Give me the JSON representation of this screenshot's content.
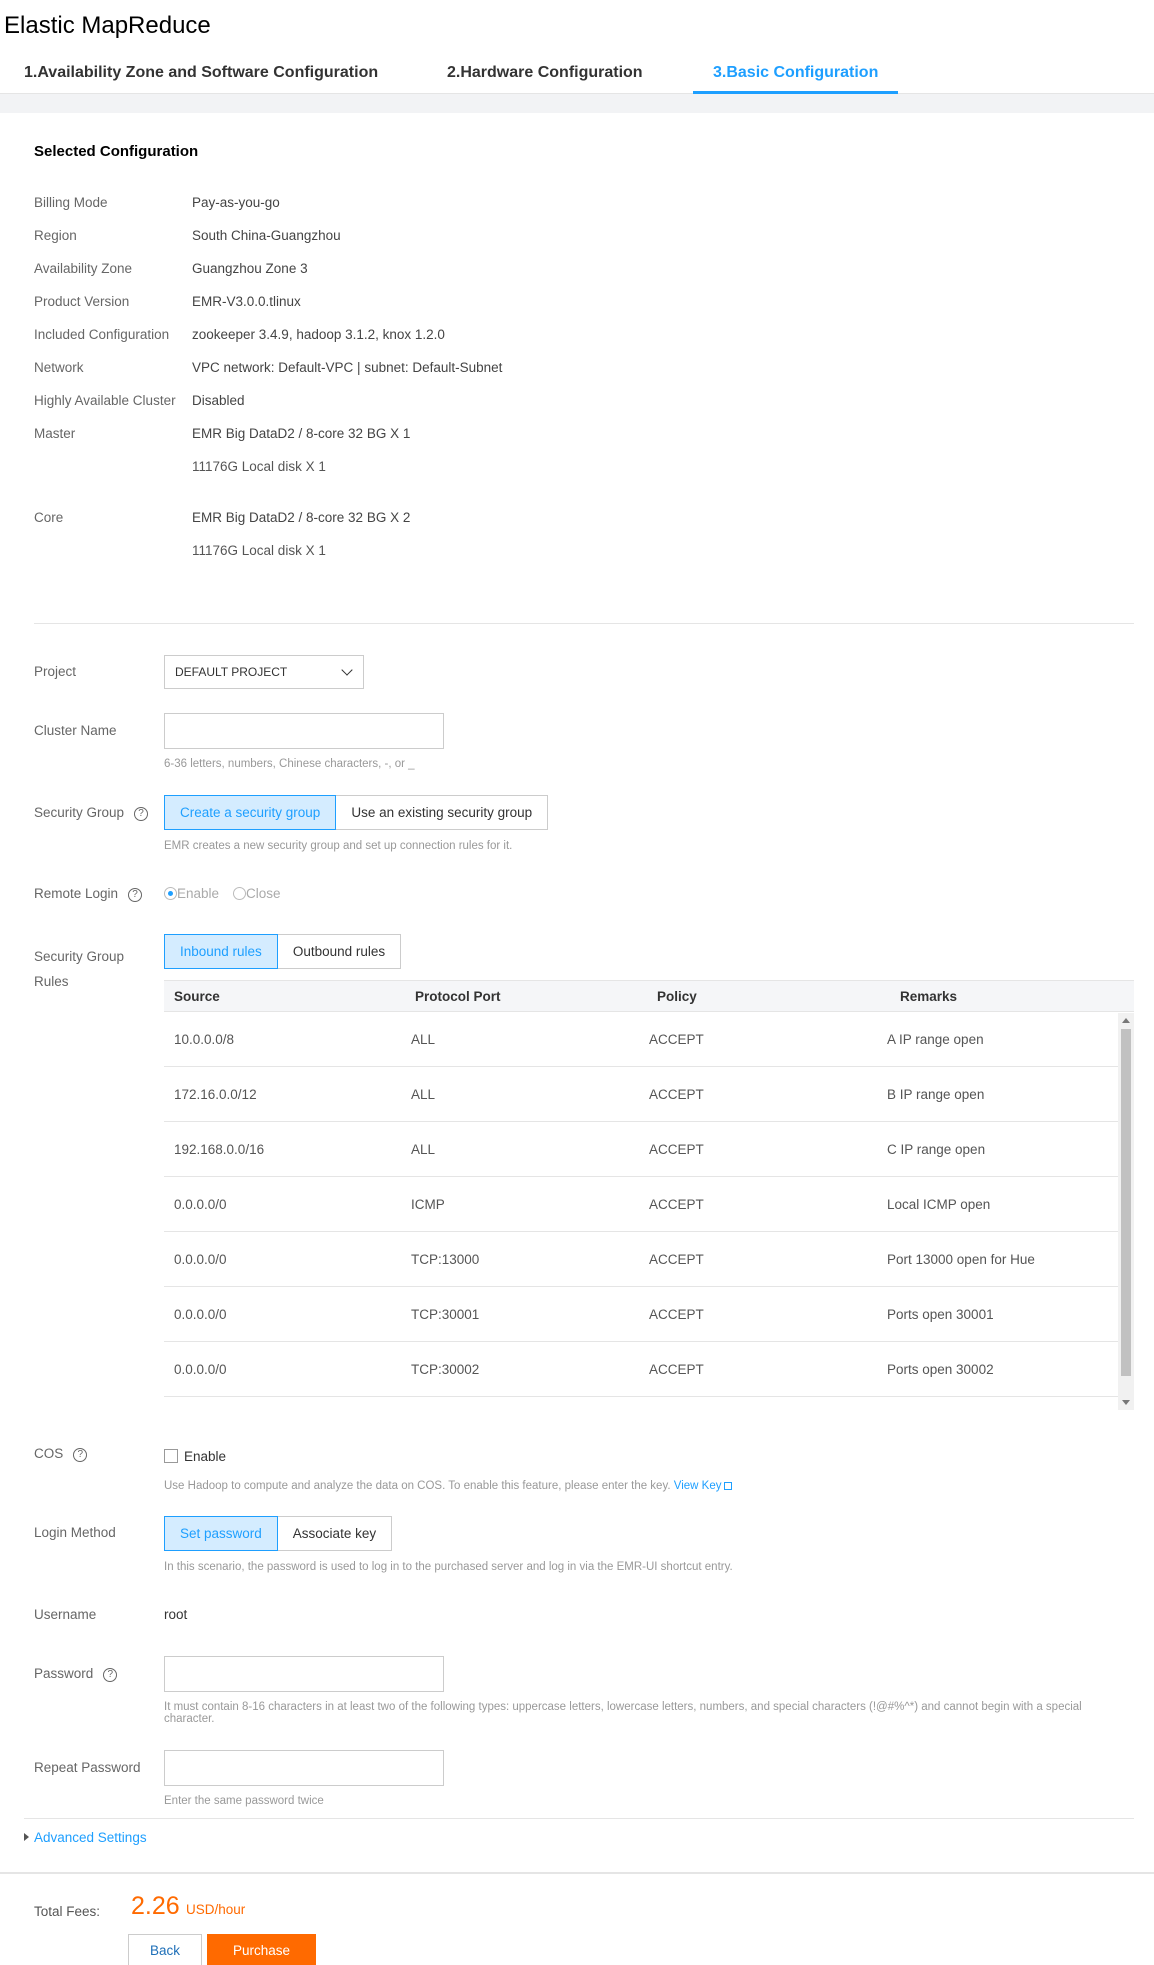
{
  "app": {
    "title": "Elastic MapReduce"
  },
  "steps": [
    {
      "label": "1.Availability Zone and Software Configuration"
    },
    {
      "label": "2.Hardware Configuration"
    },
    {
      "label": "3.Basic Configuration"
    }
  ],
  "selected": {
    "title": "Selected Configuration",
    "rows": [
      {
        "label": "Billing Mode",
        "value": "Pay-as-you-go"
      },
      {
        "label": "Region",
        "value": "South China-Guangzhou"
      },
      {
        "label": "Availability Zone",
        "value": "Guangzhou Zone 3"
      },
      {
        "label": "Product Version",
        "value": "EMR-V3.0.0.tlinux"
      },
      {
        "label": "Included Configuration",
        "value": "zookeeper 3.4.9, hadoop 3.1.2, knox 1.2.0"
      },
      {
        "label": "Network",
        "value": "VPC network: Default-VPC | subnet: Default-Subnet"
      },
      {
        "label": "Highly Available Cluster",
        "value": "Disabled"
      },
      {
        "label": "Master",
        "value": "EMR Big DataD2 / 8-core 32 BG X 1",
        "value2": "11176G Local disk X 1"
      },
      {
        "label": "Core",
        "value": "EMR Big DataD2 / 8-core 32 BG X 2",
        "value2": "11176G Local disk X 1"
      }
    ]
  },
  "form": {
    "project": {
      "label": "Project",
      "value": "DEFAULT PROJECT"
    },
    "cluster_name": {
      "label": "Cluster Name",
      "value": "",
      "hint": "6-36 letters, numbers, Chinese characters, -, or _"
    },
    "security_group": {
      "label": "Security Group",
      "options": [
        "Create a security group",
        "Use an existing security group"
      ],
      "hint": "EMR creates a new security group and set up connection rules for it."
    },
    "remote_login": {
      "label": "Remote Login",
      "options": [
        "Enable",
        "Close"
      ]
    },
    "sg_rules": {
      "label_line1": "Security Group",
      "label_line2": "Rules",
      "tabs": [
        "Inbound rules",
        "Outbound rules"
      ],
      "columns": [
        "Source",
        "Protocol Port",
        "Policy",
        "Remarks"
      ],
      "rows": [
        [
          "10.0.0.0/8",
          "ALL",
          "ACCEPT",
          "A IP range open"
        ],
        [
          "172.16.0.0/12",
          "ALL",
          "ACCEPT",
          "B IP range open"
        ],
        [
          "192.168.0.0/16",
          "ALL",
          "ACCEPT",
          "C IP range open"
        ],
        [
          "0.0.0.0/0",
          "ICMP",
          "ACCEPT",
          "Local ICMP open"
        ],
        [
          "0.0.0.0/0",
          "TCP:13000",
          "ACCEPT",
          "Port 13000 open for Hue"
        ],
        [
          "0.0.0.0/0",
          "TCP:30001",
          "ACCEPT",
          "Ports open 30001"
        ],
        [
          "0.0.0.0/0",
          "TCP:30002",
          "ACCEPT",
          "Ports open 30002"
        ]
      ]
    },
    "cos": {
      "label": "COS",
      "checkbox": "Enable",
      "hint": "Use Hadoop to compute and analyze the data on COS. To enable this feature, please enter the key.",
      "link": "View Key"
    },
    "login_method": {
      "label": "Login Method",
      "options": [
        "Set password",
        "Associate key"
      ],
      "hint": "In this scenario, the password is used to log in to the purchased server and log in via the EMR-UI shortcut entry."
    },
    "username": {
      "label": "Username",
      "value": "root"
    },
    "password": {
      "label": "Password",
      "hint": "It must contain 8-16 characters in at least two of the following types: uppercase letters, lowercase letters, numbers, and special characters (!@#%^*) and cannot begin with a special character."
    },
    "repeat_password": {
      "label": "Repeat Password",
      "hint": "Enter the same password twice"
    },
    "advanced": "Advanced Settings"
  },
  "footer": {
    "fee_label": "Total Fees:",
    "amount": "2.26",
    "unit": "USD/hour",
    "back": "Back",
    "purchase": "Purchase"
  },
  "colors": {
    "accent": "#1e9fff",
    "purchase": "#ff6a00"
  },
  "icons": {
    "help": "question-circle-icon",
    "external": "external-link-icon",
    "dropdown": "chevron-down-icon"
  }
}
